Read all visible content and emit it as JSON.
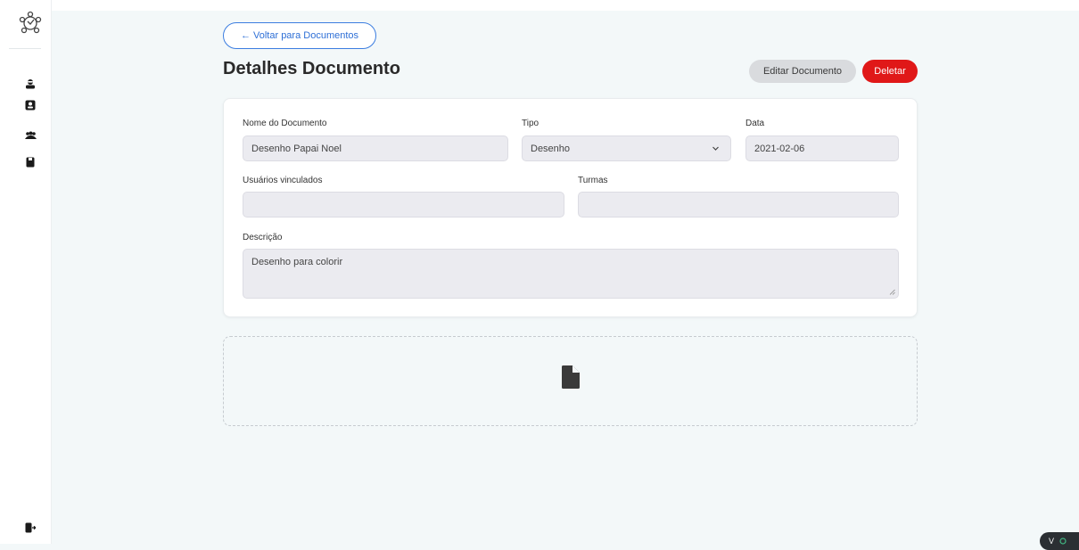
{
  "nav": {
    "back_label": "← Voltar para Documentos",
    "sidebar_icons": [
      "app-logo-icon",
      "user-icon",
      "id-card-icon",
      "users-group-icon",
      "book-icon",
      "logout-icon"
    ]
  },
  "header": {
    "title": "Detalhes Documento",
    "edit_label": "Editar Documento",
    "delete_label": "Deletar"
  },
  "form": {
    "name_label": "Nome do Documento",
    "name_value": "Desenho Papai Noel",
    "type_label": "Tipo",
    "type_value": "Desenho",
    "date_label": "Data",
    "date_value": "2021-02-06",
    "users_label": "Usuários vinculados",
    "users_value": "",
    "classes_label": "Turmas",
    "classes_value": "",
    "description_label": "Descrição",
    "description_value": "Desenho para colorir"
  },
  "upload": {
    "icon": "file-icon"
  },
  "devtools": {
    "badge_icon": "vue-devtools-icon",
    "badge_text": "V"
  },
  "colors": {
    "accent": "#3b7de0",
    "danger": "#e01818",
    "neutral_button": "#d9dbde",
    "background": "#f3f8f9"
  }
}
